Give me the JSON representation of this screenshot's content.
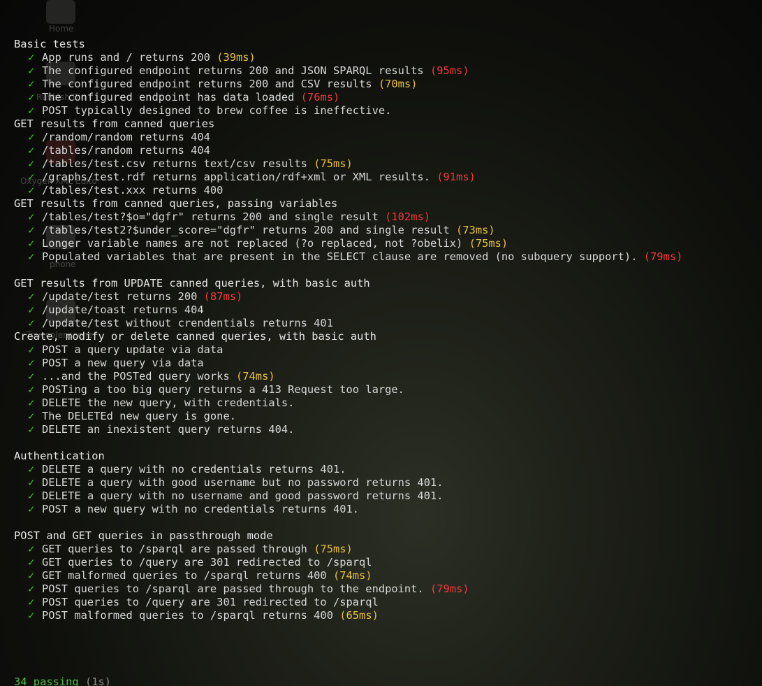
{
  "desktop": {
    "icons": [
      {
        "label": "Home"
      },
      {
        "label": "Rubbish Bin"
      },
      {
        "label": "Oxygen XML Edito"
      },
      {
        "label": "phone"
      },
      {
        "label": "Toucoolenscene"
      }
    ]
  },
  "colors": {
    "pass": "#4fbf3f",
    "medium": "#e9c23a",
    "slow": "#ee3b3b",
    "text": "#d8d8d8"
  },
  "checkmark": "✓",
  "suites": [
    {
      "title": "Basic tests",
      "tests": [
        {
          "text": "App runs and / returns 200",
          "duration": "(39ms)",
          "speed": "medium"
        },
        {
          "text": "The configured endpoint returns 200 and JSON SPARQL results",
          "duration": "(95ms)",
          "speed": "slow"
        },
        {
          "text": "The configured endpoint returns 200 and CSV results",
          "duration": "(70ms)",
          "speed": "medium"
        },
        {
          "text": "The configured endpoint has data loaded",
          "duration": "(76ms)",
          "speed": "slow"
        },
        {
          "text": "POST typically designed to brew coffee is ineffective.",
          "duration": "",
          "speed": ""
        }
      ],
      "spacer_after": false
    },
    {
      "title": "GET results from canned queries",
      "tests": [
        {
          "text": "/random/random returns 404",
          "duration": "",
          "speed": ""
        },
        {
          "text": "/tables/random returns 404",
          "duration": "",
          "speed": ""
        },
        {
          "text": "/tables/test.csv returns text/csv results",
          "duration": "(75ms)",
          "speed": "medium"
        },
        {
          "text": "/graphs/test.rdf returns application/rdf+xml or XML results.",
          "duration": "(91ms)",
          "speed": "slow"
        },
        {
          "text": "/tables/test.xxx returns 400",
          "duration": "",
          "speed": ""
        }
      ],
      "spacer_after": false
    },
    {
      "title": "GET results from canned queries, passing variables",
      "tests": [
        {
          "text": "/tables/test?$o=\"dgfr\" returns 200 and single result",
          "duration": "(102ms)",
          "speed": "slow"
        },
        {
          "text": "/tables/test2?$under_score=\"dgfr\" returns 200 and single result",
          "duration": "(73ms)",
          "speed": "medium"
        },
        {
          "text": "Longer variable names are not replaced (?o replaced, not ?obelix)",
          "duration": "(75ms)",
          "speed": "medium"
        },
        {
          "text": "Populated variables that are present in the SELECT clause are removed (no subquery support).",
          "duration": "(79ms)",
          "speed": "slow"
        }
      ],
      "spacer_after": true
    },
    {
      "title": "GET results from UPDATE canned queries, with basic auth",
      "tests": [
        {
          "text": "/update/test returns 200",
          "duration": "(87ms)",
          "speed": "slow"
        },
        {
          "text": "/update/toast returns 404",
          "duration": "",
          "speed": ""
        },
        {
          "text": "/update/test without crendentials returns 401",
          "duration": "",
          "speed": ""
        }
      ],
      "spacer_after": false
    },
    {
      "title": "Create, modify or delete canned queries, with basic auth",
      "tests": [
        {
          "text": "POST a query update via data",
          "duration": "",
          "speed": ""
        },
        {
          "text": "POST a new query via data",
          "duration": "",
          "speed": ""
        },
        {
          "text": "...and the POSTed query works",
          "duration": "(74ms)",
          "speed": "medium"
        },
        {
          "text": "POSTing a too big query returns a 413 Request too large.",
          "duration": "",
          "speed": ""
        },
        {
          "text": "DELETE the new query, with credentials.",
          "duration": "",
          "speed": ""
        },
        {
          "text": "The DELETEd new query is gone.",
          "duration": "",
          "speed": ""
        },
        {
          "text": "DELETE an inexistent query returns 404.",
          "duration": "",
          "speed": ""
        }
      ],
      "spacer_after": true
    },
    {
      "title": "Authentication",
      "tests": [
        {
          "text": "DELETE a query with no credentials returns 401.",
          "duration": "",
          "speed": ""
        },
        {
          "text": "DELETE a query with good username but no password returns 401.",
          "duration": "",
          "speed": ""
        },
        {
          "text": "DELETE a query with no username and good password returns 401.",
          "duration": "",
          "speed": ""
        },
        {
          "text": "POST a new query with no credentials returns 401.",
          "duration": "",
          "speed": ""
        }
      ],
      "spacer_after": true
    },
    {
      "title": "POST and GET queries in passthrough mode",
      "tests": [
        {
          "text": "GET queries to /sparql are passed through",
          "duration": "(75ms)",
          "speed": "medium"
        },
        {
          "text": "GET queries to /query are 301 redirected to /sparql",
          "duration": "",
          "speed": ""
        },
        {
          "text": "GET malformed queries to /sparql returns 400",
          "duration": "(74ms)",
          "speed": "medium"
        },
        {
          "text": "POST queries to /sparql are passed through to the endpoint.",
          "duration": "(79ms)",
          "speed": "slow"
        },
        {
          "text": "POST queries to /query are 301 redirected to /sparql",
          "duration": "",
          "speed": ""
        },
        {
          "text": "POST malformed queries to /sparql returns 400",
          "duration": "(65ms)",
          "speed": "medium"
        }
      ],
      "spacer_after": false
    }
  ],
  "summary": {
    "passing": "34 passing",
    "elapsed": "(1s)"
  }
}
